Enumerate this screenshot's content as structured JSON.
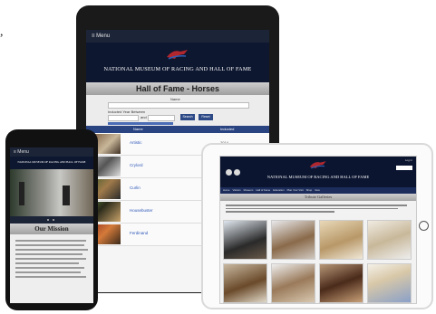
{
  "stray_char": ",",
  "tablet_portrait": {
    "menu": "≡ Menu",
    "header_title": "NATIONAL MUSEUM OF RACING AND HALL OF FAME",
    "banner": "Hall of Fame - Horses",
    "form": {
      "name_label": "Name",
      "inducted_label": "Inducted Year Between",
      "and_label": "and",
      "search_button": "Search",
      "reset_button": "Reset"
    },
    "table_columns": [
      "Name",
      "Inducted"
    ],
    "rows": [
      {
        "name": "Artistic",
        "year": "2014"
      },
      {
        "name": "Crylord",
        "year": ""
      },
      {
        "name": "Curlin",
        "year": ""
      },
      {
        "name": "Housebuster",
        "year": ""
      },
      {
        "name": "Ferdinand",
        "year": ""
      }
    ]
  },
  "phone": {
    "menu": "≡ Menu",
    "header_title": "NATIONAL MUSEUM OF RACING AND HALL OF FAME",
    "mission_title": "Our Mission"
  },
  "tablet_landscape": {
    "login": "Log in",
    "header_title": "NATIONAL MUSEUM OF RACING AND HALL OF FAME",
    "nav": [
      "Home",
      "Visitors",
      "Museum",
      "Hall of Fame",
      "Education",
      "Plan Your Visit",
      "Shop",
      "Give"
    ],
    "section_title": "Tribute Galleries"
  },
  "colors": {
    "navy": "#0d1730",
    "link_blue": "#2d56b8",
    "accent_red": "#b2272d"
  }
}
